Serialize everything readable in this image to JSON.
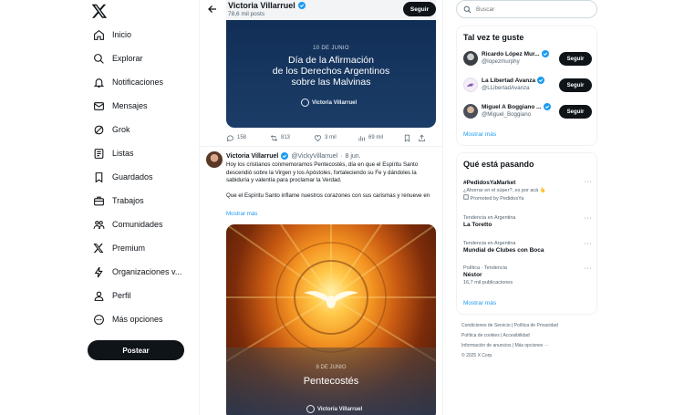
{
  "nav": {
    "items": [
      {
        "label": "Inicio",
        "icon": "home-icon"
      },
      {
        "label": "Explorar",
        "icon": "search-icon"
      },
      {
        "label": "Notificaciones",
        "icon": "bell-icon"
      },
      {
        "label": "Mensajes",
        "icon": "mail-icon"
      },
      {
        "label": "Grok",
        "icon": "grok-icon"
      },
      {
        "label": "Listas",
        "icon": "list-icon"
      },
      {
        "label": "Guardados",
        "icon": "bookmark-icon"
      },
      {
        "label": "Trabajos",
        "icon": "briefcase-icon"
      },
      {
        "label": "Comunidades",
        "icon": "people-icon"
      },
      {
        "label": "Premium",
        "icon": "x-icon"
      },
      {
        "label": "Organizaciones v...",
        "icon": "lightning-icon"
      },
      {
        "label": "Perfil",
        "icon": "person-icon"
      },
      {
        "label": "Más opciones",
        "icon": "more-circle-icon"
      }
    ],
    "post_button": "Postear"
  },
  "header": {
    "name": "Victoria Villarruel",
    "posts": "78,6 mil posts",
    "follow": "Seguir"
  },
  "tweet1": {
    "media": {
      "date": "10 DE JUNIO",
      "title_lines": [
        "Día de la Afirmación",
        "de los Derechos Argentinos",
        "sobre las Malvinas"
      ],
      "brand": "Victoria Villarruel"
    },
    "actions": {
      "replies": "158",
      "reposts": "813",
      "likes": "3 mil",
      "views": "69 mil"
    }
  },
  "tweet2": {
    "name": "Victoria Villarruel",
    "handle": "@VickyVillarruel",
    "time": "8 jun.",
    "text_p1": "Hoy los cristianos conmemoramos Pentecostés, día en que el Espíritu Santo descendió sobre la Virgen y los Apóstoles, fortaleciendo su Fe y dándoles la sabiduría y valentía para proclamar la Verdad.",
    "text_p2": "Que el Espíritu Santo inflame nuestros corazones con sus carismas y renueve en",
    "show_more": "Mostrar más",
    "media": {
      "date": "8 DE JUNIO",
      "title": "Pentecostés",
      "brand": "Victoria Villarruel"
    }
  },
  "search": {
    "placeholder": "Buscar"
  },
  "who_to_follow": {
    "title": "Tal vez te guste",
    "follow_label": "Seguir",
    "users": [
      {
        "name": "Ricardo López Mur...",
        "handle": "@lopezmurphy"
      },
      {
        "name": "La Libertad Avanza",
        "handle": "@LLibertadAvanza"
      },
      {
        "name": "Miguel A Boggiano ...",
        "handle": "@Miguel_Boggiano"
      }
    ],
    "more": "Mostrar más"
  },
  "trends": {
    "title": "Qué está pasando",
    "items": [
      {
        "context": "",
        "title": "#PedidosYaMarket",
        "sub": "¿Ahorrar en el súper?, es por acá 👆",
        "promo": "Promoted by PedidosYa"
      },
      {
        "context": "Tendencia en Argentina",
        "title": "La Toretto",
        "sub": "",
        "promo": ""
      },
      {
        "context": "Tendencia en Argentina",
        "title": "Mundial de Clubes con Boca",
        "sub": "",
        "promo": ""
      },
      {
        "context": "Política · Tendencia",
        "title": "Néstor",
        "sub": "16,7 mil publicaciones",
        "promo": ""
      }
    ],
    "more": "Mostrar más"
  },
  "footer": {
    "line1": [
      "Condiciones de Servicio",
      "Política de Privacidad"
    ],
    "line2": [
      "Política de cookies",
      "Accesibilidad"
    ],
    "line3": [
      "Información de anuncios",
      "Más opciones ···"
    ],
    "copyright": "© 2025 X Corp."
  },
  "colors": {
    "accent": "#1d9bf0",
    "text": "#0f1419",
    "muted": "#536471",
    "button": "#0f1419"
  }
}
